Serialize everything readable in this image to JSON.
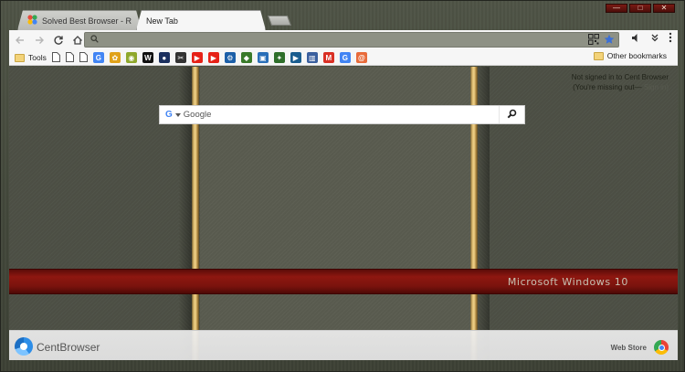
{
  "tabs": [
    {
      "label": "Solved Best Browser - Repo",
      "active": false
    },
    {
      "label": "New Tab",
      "active": true
    }
  ],
  "window_controls": {
    "minimize": "—",
    "maximize": "□",
    "close": "✕"
  },
  "toolbar": {
    "back_icon": "arrow-left-icon",
    "forward_icon": "arrow-right-icon",
    "reload_icon": "reload-icon",
    "home_icon": "home-icon",
    "omnibox_value": "",
    "right_icons": [
      "qr-code-icon",
      "star-icon",
      "speaker-icon",
      "chevrons-down-icon",
      "menu-icon"
    ]
  },
  "bookmarks": {
    "items": [
      {
        "label": "Tools",
        "icon": "folder-icon"
      },
      {
        "label": "",
        "icon": "page-icon"
      },
      {
        "label": "",
        "icon": "page-icon"
      },
      {
        "label": "",
        "icon": "page-icon"
      },
      {
        "label": "",
        "icon": "google-icon",
        "glyph": "G",
        "color": "#4285f4"
      },
      {
        "label": "",
        "icon": "photos-icon",
        "glyph": "✿",
        "color": "#e0a21a"
      },
      {
        "label": "",
        "icon": "globe-icon",
        "glyph": "◉",
        "color": "#8fa82c"
      },
      {
        "label": "",
        "icon": "wikipedia-icon",
        "glyph": "W",
        "color": "#111111"
      },
      {
        "label": "",
        "icon": "dark-circle-icon",
        "glyph": "●",
        "color": "#1b2f5e"
      },
      {
        "label": "",
        "icon": "tools-icon",
        "glyph": "✂",
        "color": "#333333"
      },
      {
        "label": "",
        "icon": "youtube-icon",
        "glyph": "▶",
        "color": "#e62117"
      },
      {
        "label": "",
        "icon": "youtube-icon",
        "glyph": "▶",
        "color": "#e62117"
      },
      {
        "label": "",
        "icon": "settings-icon",
        "glyph": "⚙",
        "color": "#1c5fa8"
      },
      {
        "label": "",
        "icon": "turtle-icon",
        "glyph": "◆",
        "color": "#3a7a2a"
      },
      {
        "label": "",
        "icon": "doc-blue-icon",
        "glyph": "▣",
        "color": "#2a6fb8"
      },
      {
        "label": "",
        "icon": "map-icon",
        "glyph": "✦",
        "color": "#2e6e2a"
      },
      {
        "label": "",
        "icon": "play-icon",
        "glyph": "▶",
        "color": "#1a5d8f"
      },
      {
        "label": "",
        "icon": "chart-icon",
        "glyph": "▥",
        "color": "#3a5f9e"
      },
      {
        "label": "",
        "icon": "gmail-icon",
        "glyph": "M",
        "color": "#d93025"
      },
      {
        "label": "",
        "icon": "chrome-g-icon",
        "glyph": "G",
        "color": "#4285f4"
      },
      {
        "label": "",
        "icon": "at-icon",
        "glyph": "@",
        "color": "#e86b3a"
      }
    ],
    "other": {
      "label": "Other bookmarks",
      "icon": "folder-icon"
    }
  },
  "ntp": {
    "signin_line1": "Not signed in to Cent Browser",
    "signin_line2": "(You're missing out—",
    "signin_link": "Sign in)",
    "search_logo": "G",
    "search_placeholder": "Google",
    "band_text": "Microsoft  Windows  10",
    "brand_name": "CentBrowser",
    "webstore_label": "Web Store"
  },
  "colors": {
    "frame": "#4a4e40",
    "band": "#8e1710",
    "rail": "#e0bd72",
    "toolbar": "#f6f6f6"
  }
}
